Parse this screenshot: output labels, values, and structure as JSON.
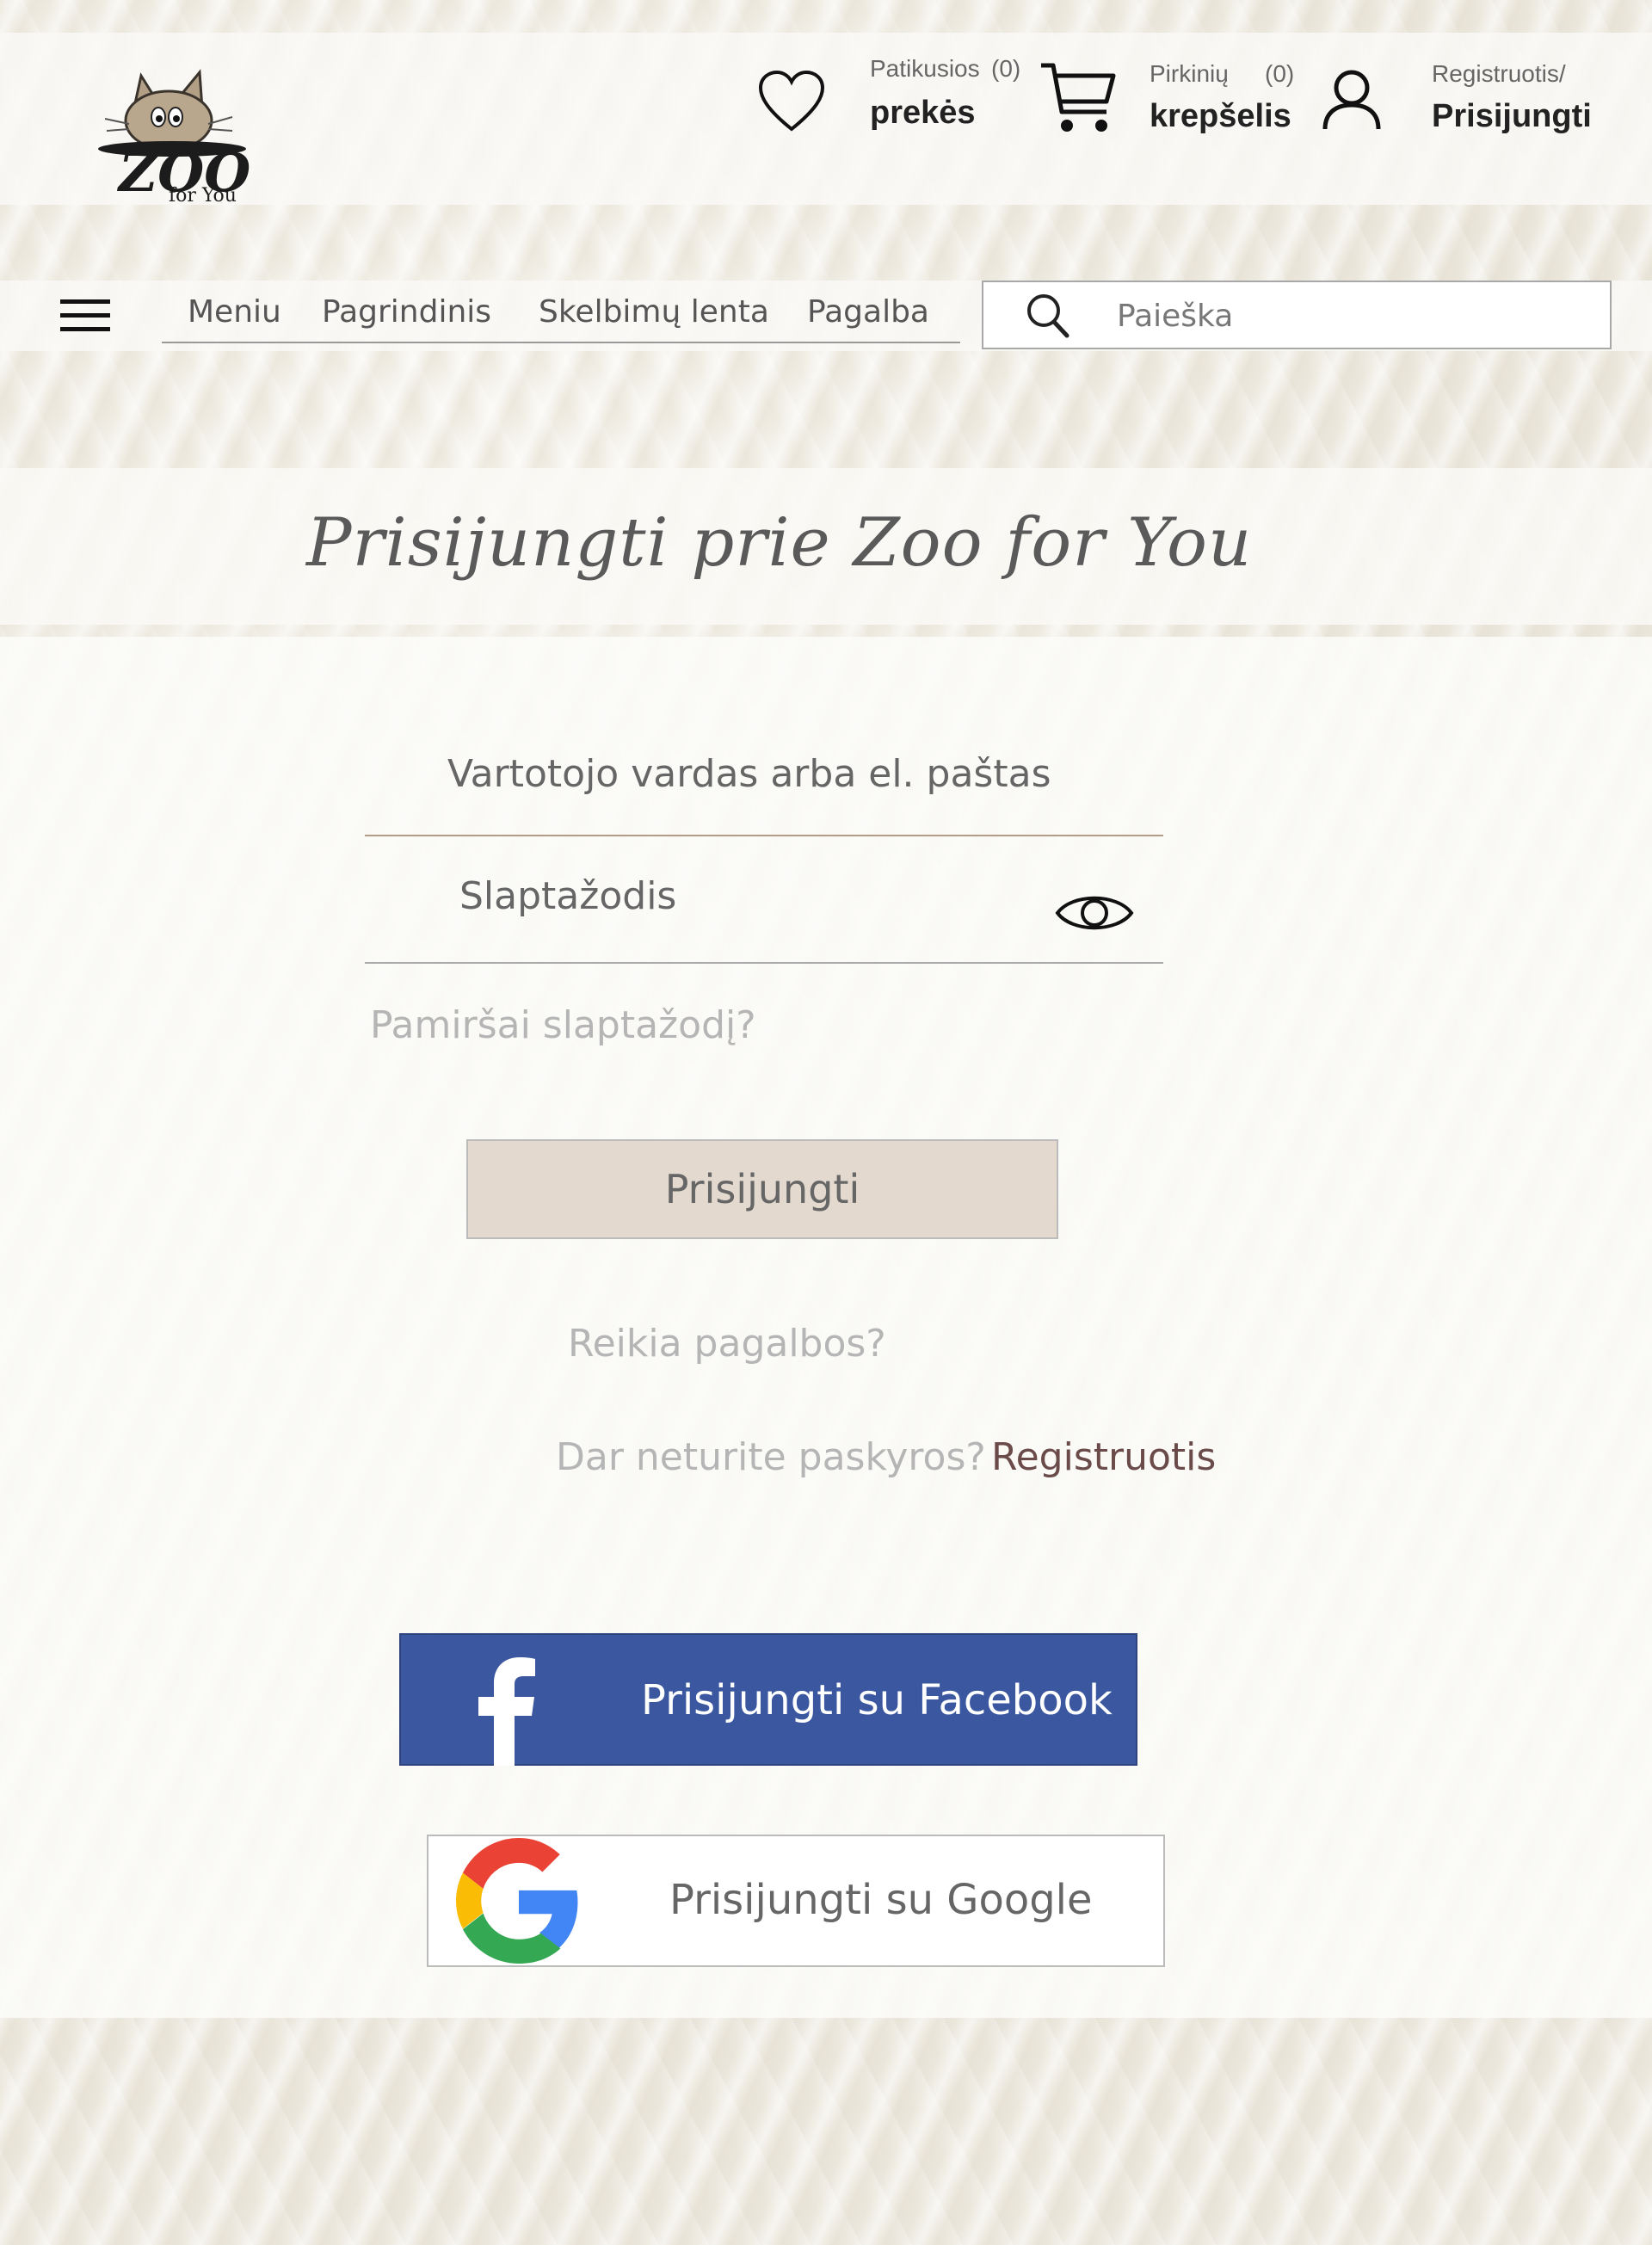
{
  "brand": {
    "logo_main": "ZOO",
    "logo_sub": "for You"
  },
  "header": {
    "favorites": {
      "small_label": "Patikusios",
      "count": "(0)",
      "big_label": "prekės",
      "icon": "heart-icon"
    },
    "cart": {
      "small_label": "Pirkinių",
      "count": "(0)",
      "big_label": "krepšelis",
      "icon": "cart-icon"
    },
    "account": {
      "small_label": "Registruotis/",
      "big_label": "Prisijungti",
      "icon": "user-icon"
    }
  },
  "nav": {
    "menu_icon": "hamburger-icon",
    "items": [
      {
        "label": "Meniu"
      },
      {
        "label": "Pagrindinis"
      },
      {
        "label": "Skelbimų lenta"
      },
      {
        "label": "Pagalba"
      }
    ],
    "search": {
      "placeholder": "Paieška",
      "icon": "search-icon"
    }
  },
  "page": {
    "title": "Prisijungti prie Zoo for You"
  },
  "form": {
    "username_placeholder": "Vartotojo vardas arba el. paštas",
    "password_placeholder": "Slaptažodis",
    "password_toggle_icon": "eye-icon",
    "forgot_password": "Pamiršai slaptažodį?",
    "submit_label": "Prisijungti",
    "help_link": "Reikia pagalbos?",
    "no_account_text": "Dar neturite paskyros?",
    "register_link": "Registruotis",
    "facebook_label": "Prisijungti su Facebook",
    "google_label": "Prisijungti su Google"
  },
  "colors": {
    "facebook": "#3b57a0",
    "login_button": "#e3d9cf",
    "register_link": "#6b4a4a",
    "muted_text": "#b5b5b5"
  }
}
